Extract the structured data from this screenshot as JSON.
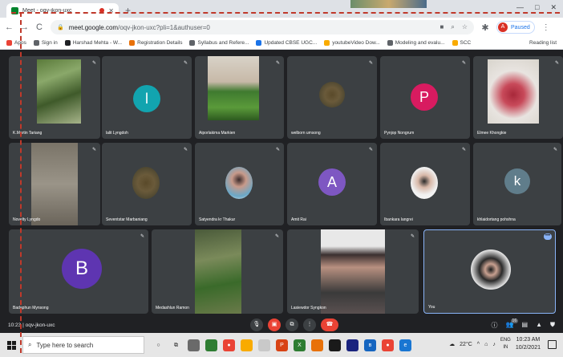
{
  "browser": {
    "tab_title": "Meet - oqv-jkon-uxc",
    "new_tab": "+",
    "window_controls": [
      "—",
      "□",
      "✕"
    ],
    "back": "←",
    "forward": "→",
    "reload": "C",
    "url_host": "meet.google.com",
    "url_rest": "/oqv-jkon-uxc?pli=1&authuser=0",
    "profile_initial": "A",
    "profile_status": "Paused"
  },
  "bookmarks": [
    {
      "label": "Apps",
      "color": "#ea4335"
    },
    {
      "label": "Sign in",
      "color": "#5f6368"
    },
    {
      "label": "Harshad Mehta - W...",
      "color": "#202124"
    },
    {
      "label": "Registration Details",
      "color": "#e8710a"
    },
    {
      "label": "Syllabus and Refere...",
      "color": "#5f6368"
    },
    {
      "label": "Updated CBSE UGC...",
      "color": "#1a73e8"
    },
    {
      "label": "youtubeVideo Dow...",
      "color": "#f9ab00"
    },
    {
      "label": "Modeling and evalu...",
      "color": "#5f6368"
    },
    {
      "label": "SCC",
      "color": "#f9ab00"
    }
  ],
  "reading_list": "Reading list",
  "participants": [
    {
      "name": "K.Martin Tariang"
    },
    {
      "name": "lalit Lyngdoh",
      "initial": "l",
      "color": "#12a4af"
    },
    {
      "name": "Aiporlakima Markien"
    },
    {
      "name": "welborn umsong"
    },
    {
      "name": "Pynjop Nongrum",
      "initial": "P",
      "color": "#d81b60"
    },
    {
      "name": "Elmee Khongkie"
    },
    {
      "name": "Novelty Lyngdo"
    },
    {
      "name": "Seventstar Marbaniang"
    },
    {
      "name": "Satyendra kr Thakur"
    },
    {
      "name": "Amit Rai",
      "initial": "A",
      "color": "#7e57c2"
    },
    {
      "name": "Ibankara langrei"
    },
    {
      "name": "khlaidortang pohshna",
      "initial": "k",
      "color": "#607d8b"
    },
    {
      "name": "Badaphun Mynsong",
      "initial": "B",
      "color": "#5e35b1"
    },
    {
      "name": "Medashlun Ramon"
    },
    {
      "name": "Lasiewdor Syngkon"
    },
    {
      "name": "You"
    }
  ],
  "meeting": {
    "time": "10:23",
    "separator": "|",
    "code": "oqv-jkon-uxc",
    "more_badge": "•••",
    "people_count": "16"
  },
  "taskbar": {
    "search_placeholder": "Type here to search",
    "temperature": "22°C",
    "lang_top": "ENG",
    "lang_bottom": "IN",
    "clock_time": "10:23 AM",
    "clock_date": "10/2/2021"
  }
}
